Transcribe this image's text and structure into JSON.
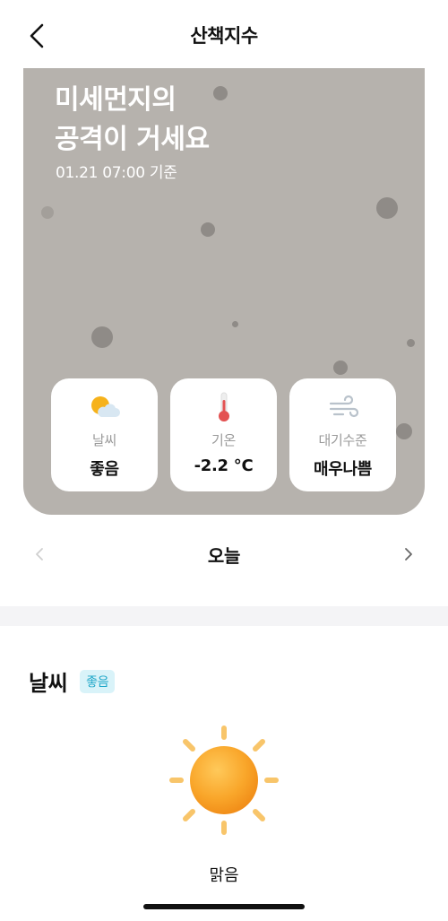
{
  "header": {
    "title": "산책지수",
    "back_icon": "chevron-left-icon"
  },
  "hero": {
    "title_line1": "미세먼지의",
    "title_line2": "공격이 거세요",
    "subtitle": "01.21 07:00 기준",
    "background_color": "#b6b2ad"
  },
  "cards": [
    {
      "icon": "sun-cloud-icon",
      "label": "날씨",
      "value": "좋음"
    },
    {
      "icon": "thermometer-icon",
      "label": "기온",
      "value": "-2.2 °C"
    },
    {
      "icon": "wind-icon",
      "label": "대기수준",
      "value": "매우나쁨"
    }
  ],
  "day_nav": {
    "label": "오늘",
    "prev_icon": "chevron-left-icon",
    "next_icon": "chevron-right-icon"
  },
  "weather_section": {
    "title": "날씨",
    "badge": "좋음",
    "badge_color": "#1da6c8",
    "illustration": "sun-icon",
    "condition": "맑음"
  }
}
